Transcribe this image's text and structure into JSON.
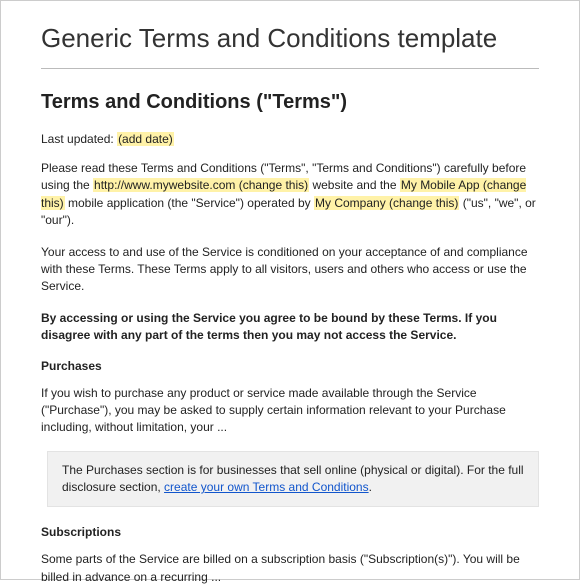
{
  "page_title": "Generic Terms and Conditions template",
  "heading": "Terms and Conditions (\"Terms\")",
  "last_updated_label": "Last updated: ",
  "last_updated_value": "(add date)",
  "intro_p1_a": "Please read these Terms and Conditions (\"Terms\", \"Terms and Conditions\") carefully before using the ",
  "intro_p1_url": "http://www.mywebsite.com (change this)",
  "intro_p1_b": " website and the ",
  "intro_p1_app": "My Mobile App (change this)",
  "intro_p1_c": " mobile application (the \"Service\") operated by ",
  "intro_p1_company": "My Company (change this)",
  "intro_p1_d": " (\"us\", \"we\", or \"our\").",
  "intro_p2": "Your access to and use of the Service is conditioned on your acceptance of and compliance with these Terms. These Terms apply to all visitors, users and others who access or use the Service.",
  "intro_p3": "By accessing or using the Service you agree to be bound by these Terms. If you disagree with any part of the terms then you may not access the Service.",
  "purchases": {
    "title": "Purchases",
    "text": "If you wish to purchase any product or service made available through the Service (\"Purchase\"), you may be asked to supply certain information relevant to your Purchase including, without limitation, your ...",
    "note_a": "The Purchases section is for businesses that sell online (physical or digital). For the full disclosure section, ",
    "note_link": "create your own Terms and Conditions",
    "note_b": "."
  },
  "subscriptions": {
    "title": "Subscriptions",
    "text": "Some parts of the Service are billed on a subscription basis (\"Subscription(s)\"). You will be billed in advance on a recurring ..."
  }
}
